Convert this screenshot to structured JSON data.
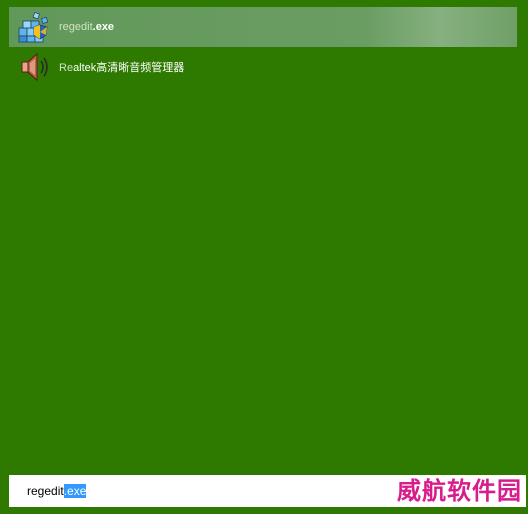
{
  "results": [
    {
      "prefix": "regedit",
      "suffix": ".exe",
      "icon": "registry-editor-icon",
      "selected": true
    },
    {
      "prefix": "Re",
      "suffix": "altek高清晰音频管理器",
      "icon": "speaker-icon",
      "selected": false
    }
  ],
  "search": {
    "typed": "regedit",
    "autocomplete": ".exe"
  },
  "watermark": "威航软件园",
  "colors": {
    "background": "#2e7a00",
    "selection": "#6a9d62",
    "text_highlight": "#3399ff",
    "watermark": "#d81c8b"
  }
}
